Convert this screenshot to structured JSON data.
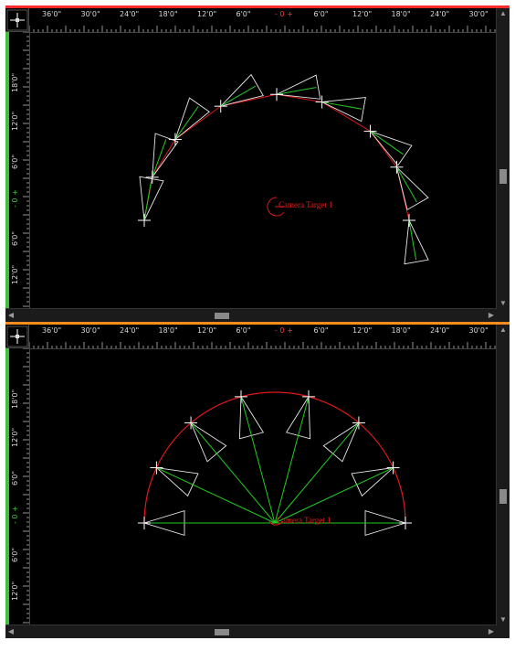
{
  "colors": {
    "top_accent": "#ff2a2a",
    "bottom_accent": "#ff8a1e",
    "ruler_green": "#3fbf3f",
    "path_red": "#e01818",
    "sight_green": "#22cc22",
    "frustum_white": "#e8e8e8",
    "background": "#000000"
  },
  "icons": {
    "corner": "move-crosshair-icon",
    "scroll_up": "triangle-up-icon",
    "scroll_down": "triangle-down-icon",
    "scroll_left": "triangle-left-icon",
    "scroll_right": "triangle-right-icon"
  },
  "ruler": {
    "horizontal_labels": [
      "36'0\"",
      "30'0\"",
      "24'0\"",
      "18'0\"",
      "12'0\"",
      "6'0\"",
      "- 0 +",
      "6'0\"",
      "12'0\"",
      "18'0\"",
      "24'0\"",
      "30'0\""
    ],
    "vertical_labels": [
      "18'0\"",
      "12'0\"",
      "6'0\"",
      "- 0 +",
      "6'0\"",
      "12'0\""
    ]
  },
  "panes": [
    {
      "name": "top",
      "target_label": "Camera Target 1",
      "camera_layout": "arc-aimed-tangent"
    },
    {
      "name": "bottom",
      "target_label": "Camera Target 1",
      "camera_layout": "semicircle-aimed-at-target"
    }
  ],
  "glyphs": {
    "up": "▲",
    "down": "▼",
    "left": "◀",
    "right": "▶"
  }
}
